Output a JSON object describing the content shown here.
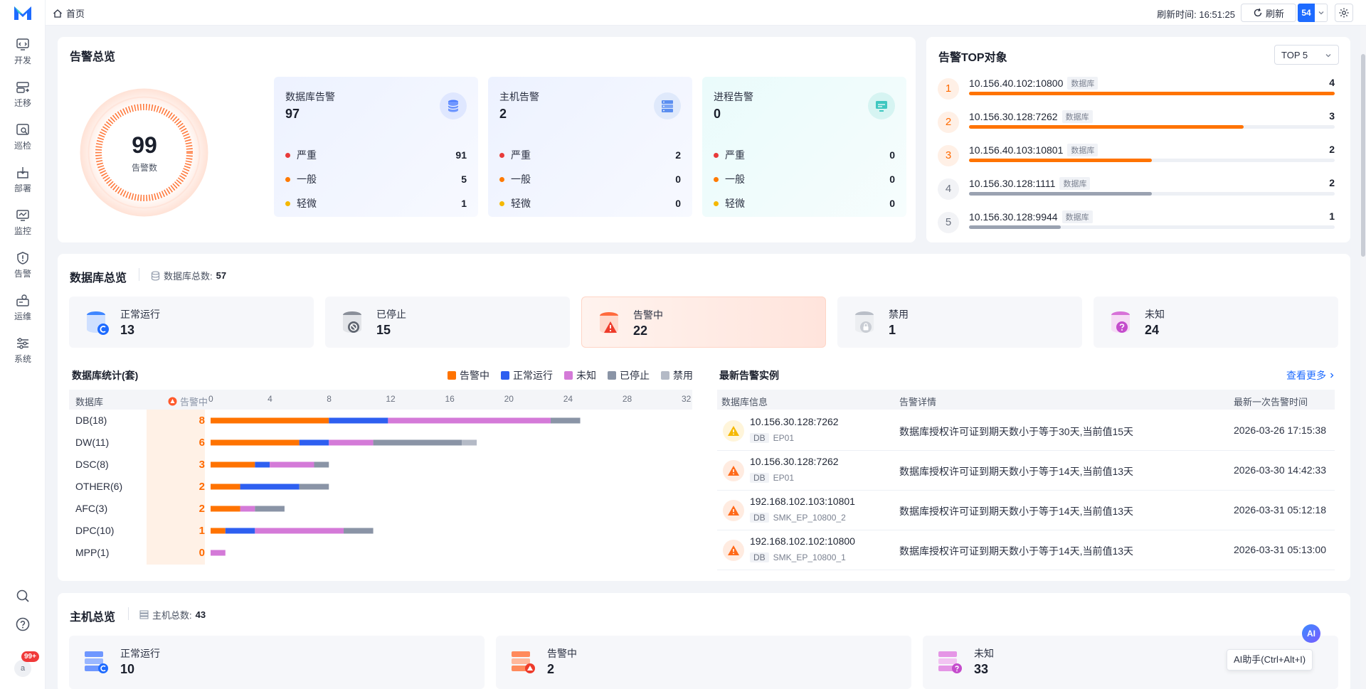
{
  "nav": {
    "items": [
      {
        "label": "开发",
        "icon": "dev-icon"
      },
      {
        "label": "迁移",
        "icon": "migrate-icon"
      },
      {
        "label": "巡检",
        "icon": "inspect-icon"
      },
      {
        "label": "部署",
        "icon": "deploy-icon"
      },
      {
        "label": "监控",
        "icon": "monitor-icon"
      },
      {
        "label": "告警",
        "icon": "alert-shield-icon"
      },
      {
        "label": "运维",
        "icon": "ops-icon"
      },
      {
        "label": "系统",
        "icon": "system-sliders-icon"
      }
    ],
    "avatar": "a",
    "notification_count": "99+"
  },
  "header": {
    "breadcrumb": "首页",
    "refresh_time_label": "刷新时间: 16:51:25",
    "refresh_button": "刷新",
    "refresh_interval": "54"
  },
  "alarm_overview": {
    "title": "告警总览",
    "total": "99",
    "total_label": "告警数",
    "cards": [
      {
        "title": "数据库告警",
        "count": "97",
        "severe_label": "严重",
        "severe": "91",
        "general_label": "一般",
        "general": "5",
        "minor_label": "轻微",
        "minor": "1"
      },
      {
        "title": "主机告警",
        "count": "2",
        "severe_label": "严重",
        "severe": "2",
        "general_label": "一般",
        "general": "0",
        "minor_label": "轻微",
        "minor": "0"
      },
      {
        "title": "进程告警",
        "count": "0",
        "severe_label": "严重",
        "severe": "0",
        "general_label": "一般",
        "general": "0",
        "minor_label": "轻微",
        "minor": "0"
      }
    ],
    "colors": {
      "severe": "#e83a3a",
      "general": "#ff7a00",
      "minor": "#f5b800"
    }
  },
  "top_objects": {
    "title": "告警TOP对象",
    "select": "TOP 5",
    "items": [
      {
        "rank": "1",
        "name": "10.156.40.102:10800",
        "tag": "数据库",
        "value": "4",
        "fraction": 1.0
      },
      {
        "rank": "2",
        "name": "10.156.30.128:7262",
        "tag": "数据库",
        "value": "3",
        "fraction": 0.75
      },
      {
        "rank": "3",
        "name": "10.156.40.103:10801",
        "tag": "数据库",
        "value": "2",
        "fraction": 0.5
      },
      {
        "rank": "4",
        "name": "10.156.30.128:1111",
        "tag": "数据库",
        "value": "2",
        "fraction": 0.5
      },
      {
        "rank": "5",
        "name": "10.156.30.128:9944",
        "tag": "数据库",
        "value": "1",
        "fraction": 0.25
      }
    ]
  },
  "db_overview": {
    "title": "数据库总览",
    "total_label": "数据库总数:",
    "total": "57",
    "statuses": [
      {
        "label": "正常运行",
        "value": "13",
        "icon": "db-running-icon"
      },
      {
        "label": "已停止",
        "value": "15",
        "icon": "db-stopped-icon"
      },
      {
        "label": "告警中",
        "value": "22",
        "icon": "db-alerting-icon"
      },
      {
        "label": "禁用",
        "value": "1",
        "icon": "db-disabled-icon"
      },
      {
        "label": "未知",
        "value": "24",
        "icon": "db-unknown-icon"
      }
    ]
  },
  "db_stats": {
    "title": "数据库统计(套)",
    "col_db": "数据库",
    "col_alert": "告警中",
    "legend": [
      {
        "label": "告警中",
        "color": "#ff7300"
      },
      {
        "label": "正常运行",
        "color": "#2e5ff0"
      },
      {
        "label": "未知",
        "color": "#d47ad8"
      },
      {
        "label": "已停止",
        "color": "#8a94a6"
      },
      {
        "label": "禁用",
        "color": "#b4bac6"
      }
    ]
  },
  "chart_data": {
    "type": "bar",
    "orientation": "horizontal",
    "stacked": true,
    "categories": [
      "DB(18)",
      "DW(11)",
      "DSC(8)",
      "OTHER(6)",
      "AFC(3)",
      "DPC(10)",
      "MPP(1)"
    ],
    "xlim": [
      0,
      32
    ],
    "xticks": [
      0,
      4,
      8,
      12,
      16,
      20,
      24,
      28,
      32
    ],
    "series": [
      {
        "name": "告警中",
        "values": [
          8,
          6,
          3,
          2,
          2,
          1,
          0
        ]
      },
      {
        "name": "正常运行",
        "values": [
          4,
          2,
          1,
          4,
          0,
          2,
          0
        ]
      },
      {
        "name": "未知",
        "values": [
          11,
          3,
          3,
          0,
          1,
          6,
          1
        ]
      },
      {
        "name": "已停止",
        "values": [
          2,
          6,
          1,
          2,
          2,
          2,
          0
        ]
      },
      {
        "name": "禁用",
        "values": [
          0,
          1,
          0,
          0,
          0,
          0,
          0
        ]
      }
    ]
  },
  "latest_alerts": {
    "title": "最新告警实例",
    "more": "查看更多",
    "columns": [
      "数据库信息",
      "告警详情",
      "最新一次告警时间"
    ],
    "rows": [
      {
        "addr": "10.156.30.128:7262",
        "type": "DB",
        "ep": "EP01",
        "detail": "数据库授权许可证到期天数小于等于30天,当前值15天",
        "time": "2026-03-26 17:15:38",
        "level": "minor"
      },
      {
        "addr": "10.156.30.128:7262",
        "type": "DB",
        "ep": "EP01",
        "detail": "数据库授权许可证到期天数小于等于14天,当前值13天",
        "time": "2026-03-30 14:42:33",
        "level": "general"
      },
      {
        "addr": "192.168.102.103:10801",
        "type": "DB",
        "ep": "SMK_EP_10800_2",
        "detail": "数据库授权许可证到期天数小于等于14天,当前值13天",
        "time": "2026-03-31 05:12:18",
        "level": "general"
      },
      {
        "addr": "192.168.102.102:10800",
        "type": "DB",
        "ep": "SMK_EP_10800_1",
        "detail": "数据库授权许可证到期天数小于等于14天,当前值13天",
        "time": "2026-03-31 05:13:00",
        "level": "general"
      }
    ]
  },
  "host_overview": {
    "title": "主机总览",
    "total_label": "主机总数:",
    "total": "43",
    "statuses": [
      {
        "label": "正常运行",
        "value": "10",
        "icon": "host-running-icon"
      },
      {
        "label": "告警中",
        "value": "2",
        "icon": "host-alerting-icon"
      },
      {
        "label": "未知",
        "value": "33",
        "icon": "host-unknown-icon"
      }
    ]
  },
  "assistant": {
    "button": "AI",
    "tooltip": "AI助手(Ctrl+Alt+I)"
  }
}
